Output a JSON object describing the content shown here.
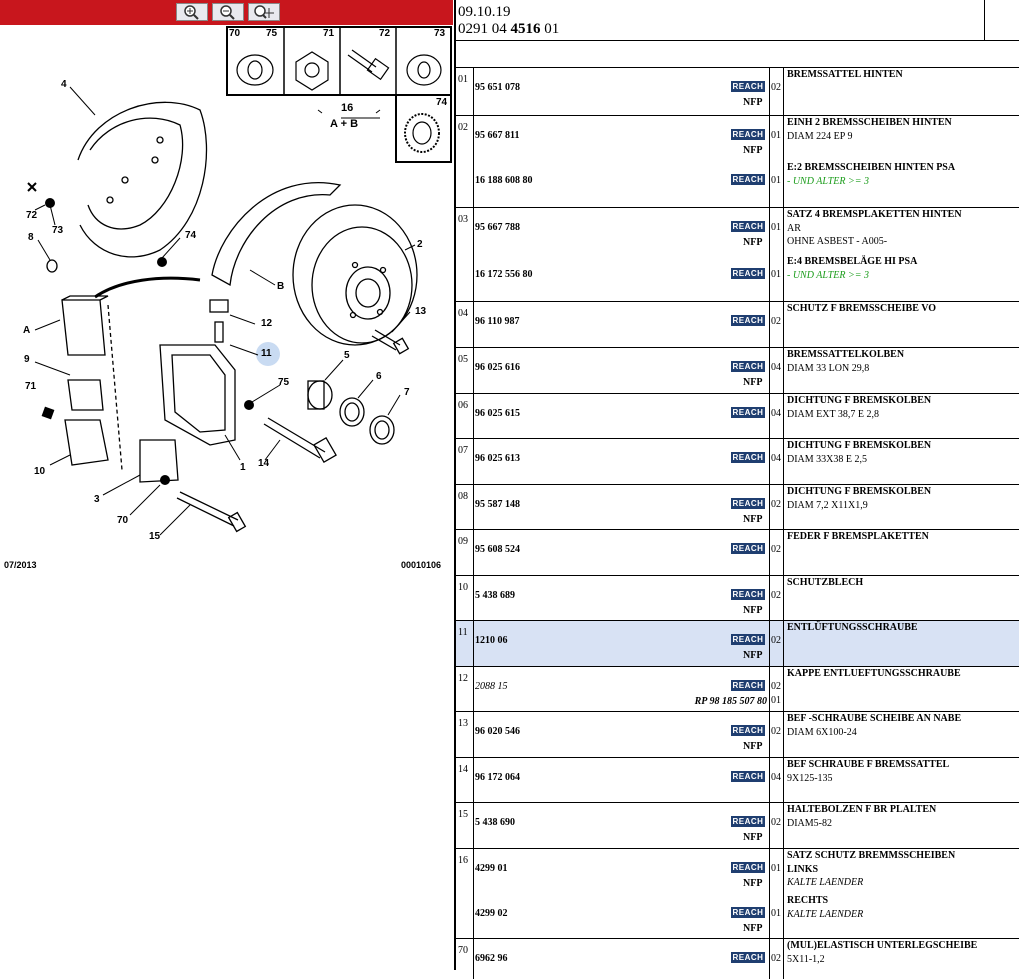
{
  "header": {
    "date": "09.10.19",
    "ref_a": "0291 04 ",
    "ref_b": "4516",
    "ref_c": " 01"
  },
  "toolbar": {
    "icons": [
      "zoom-in-icon",
      "zoom-out-icon",
      "zoom-pan-icon"
    ]
  },
  "colors": {
    "toolbar": "#c8161d",
    "reach_badge": "#1f3e70",
    "highlight": "#d8e2f4",
    "green_text": "#1a9c1a"
  },
  "diagram": {
    "inset": {
      "labels": [
        "70",
        "75",
        "71",
        "72",
        "73",
        "74"
      ],
      "group_num": "16",
      "group_sub": "A + B"
    },
    "callouts": [
      "4",
      "x",
      "72",
      "73",
      "8",
      "74",
      "B",
      "2",
      "A",
      "12",
      "13",
      "11",
      "9",
      "5",
      "71",
      "75",
      "6",
      "7",
      "1",
      "14",
      "10",
      "3",
      "70",
      "15"
    ],
    "date_code": "07/2013",
    "ref_code": "00010106"
  },
  "reach_label": "REACH",
  "rows": [
    {
      "idx": "01",
      "parts": [
        {
          "ref": "95 651 078",
          "qty": "02",
          "nfp": "NFP",
          "lines": [
            {
              "t": "BREMSSATTEL HINTEN",
              "s": "b"
            }
          ]
        }
      ]
    },
    {
      "idx": "02",
      "parts": [
        {
          "ref": "95 667 811",
          "qty": "01",
          "nfp": "NFP",
          "lines": [
            {
              "t": "EINH 2 BREMSSCHEIBEN HINTEN",
              "s": "b"
            },
            {
              "t": "DIAM 224 EP 9",
              "s": ""
            }
          ]
        },
        {
          "ref": "16 188 608 80",
          "qty": "01",
          "nfp": "",
          "lines": [
            {
              "t": "E:2 BREMSSCHEIBEN HINTEN PSA",
              "s": "b"
            },
            {
              "t": "- UND ALTER >= 3",
              "s": "g"
            }
          ]
        }
      ]
    },
    {
      "idx": "03",
      "parts": [
        {
          "ref": "95 667 788",
          "qty": "01",
          "nfp": "NFP",
          "lines": [
            {
              "t": "SATZ 4 BREMSPLAKETTEN HINTEN",
              "s": "b"
            },
            {
              "t": "AR",
              "s": ""
            },
            {
              "t": "OHNE ASBEST - A005-",
              "s": ""
            }
          ]
        },
        {
          "ref": "16 172 556 80",
          "qty": "01",
          "nfp": "",
          "lines": [
            {
              "t": "E:4 BREMSBELÄGE HI PSA",
              "s": "b"
            },
            {
              "t": "- UND ALTER >= 3",
              "s": "g"
            }
          ]
        }
      ]
    },
    {
      "idx": "04",
      "parts": [
        {
          "ref": "96 110 987",
          "qty": "02",
          "nfp": "",
          "lines": [
            {
              "t": "SCHUTZ F BREMSSCHEIBE VO",
              "s": "b"
            }
          ]
        }
      ]
    },
    {
      "idx": "05",
      "parts": [
        {
          "ref": "96 025 616",
          "qty": "04",
          "nfp": "NFP",
          "lines": [
            {
              "t": "BREMSSATTELKOLBEN",
              "s": "b"
            },
            {
              "t": "DIAM 33 LON 29,8",
              "s": ""
            }
          ]
        }
      ]
    },
    {
      "idx": "06",
      "parts": [
        {
          "ref": "96 025 615",
          "qty": "04",
          "nfp": "",
          "lines": [
            {
              "t": "DICHTUNG F BREMSKOLBEN",
              "s": "b"
            },
            {
              "t": "DIAM EXT 38,7 E 2,8",
              "s": ""
            }
          ]
        }
      ]
    },
    {
      "idx": "07",
      "parts": [
        {
          "ref": "96 025 613",
          "qty": "04",
          "nfp": "",
          "lines": [
            {
              "t": "DICHTUNG F BREMSKOLBEN",
              "s": "b"
            },
            {
              "t": "DIAM 33X38 E 2,5",
              "s": ""
            }
          ]
        }
      ]
    },
    {
      "idx": "08",
      "parts": [
        {
          "ref": "95 587 148",
          "qty": "02",
          "nfp": "NFP",
          "lines": [
            {
              "t": "DICHTUNG F BREMSKOLBEN",
              "s": "b"
            },
            {
              "t": "DIAM 7,2 X11X1,9",
              "s": ""
            }
          ]
        }
      ]
    },
    {
      "idx": "09",
      "parts": [
        {
          "ref": "95 608 524",
          "qty": "02",
          "nfp": "",
          "lines": [
            {
              "t": "FEDER F BREMSPLAKETTEN",
              "s": "b"
            }
          ]
        }
      ]
    },
    {
      "idx": "10",
      "parts": [
        {
          "ref": "5 438 689",
          "qty": "02",
          "nfp": "NFP",
          "lines": [
            {
              "t": "SCHUTZBLECH",
              "s": "b"
            }
          ]
        }
      ]
    },
    {
      "idx": "11",
      "hl": true,
      "parts": [
        {
          "ref": "1210 06",
          "qty": "02",
          "nfp": "NFP",
          "lines": [
            {
              "t": "ENTLÜFTUNGSSCHRAUBE",
              "s": "b"
            }
          ]
        }
      ]
    },
    {
      "idx": "12",
      "parts": [
        {
          "ref": "2088 15",
          "refit": true,
          "qty": "02",
          "qty2": "01",
          "nfp": "",
          "rp": "RP 98 185 507 80",
          "lines": [
            {
              "t": "KAPPE ENTLUEFTUNGSSCHRAUBE",
              "s": "b"
            }
          ]
        }
      ]
    },
    {
      "idx": "13",
      "parts": [
        {
          "ref": "96 020 546",
          "qty": "02",
          "nfp": "NFP",
          "lines": [
            {
              "t": "BEF -SCHRAUBE SCHEIBE AN NABE",
              "s": "b"
            },
            {
              "t": "DIAM 6X100-24",
              "s": ""
            }
          ]
        }
      ]
    },
    {
      "idx": "14",
      "parts": [
        {
          "ref": "96 172 064",
          "qty": "04",
          "nfp": "",
          "lines": [
            {
              "t": "BEF SCHRAUBE F BREMSSATTEL",
              "s": "b"
            },
            {
              "t": "9X125-135",
              "s": ""
            }
          ]
        }
      ]
    },
    {
      "idx": "15",
      "parts": [
        {
          "ref": "5 438 690",
          "qty": "02",
          "nfp": "NFP",
          "lines": [
            {
              "t": "HALTEBOLZEN F BR PLALTEN",
              "s": "b"
            },
            {
              "t": "DIAM5-82",
              "s": ""
            }
          ]
        }
      ]
    },
    {
      "idx": "16",
      "parts": [
        {
          "ref": "4299 01",
          "qty": "01",
          "nfp": "NFP",
          "lines": [
            {
              "t": "SATZ SCHUTZ BREMMSSCHEIBEN",
              "s": "b"
            },
            {
              "t": "LINKS",
              "s": "b"
            },
            {
              "t": "KALTE LAENDER",
              "s": "i"
            }
          ]
        },
        {
          "ref": "4299 02",
          "qty": "01",
          "nfp": "NFP",
          "lines": [
            {
              "t": "RECHTS",
              "s": "b"
            },
            {
              "t": "KALTE LAENDER",
              "s": "i"
            }
          ]
        }
      ]
    },
    {
      "idx": "70",
      "parts": [
        {
          "ref": "6962 96",
          "qty": "02",
          "nfp": "",
          "lines": [
            {
              "t": "(MUL)ELASTISCH UNTERLEGSCHEIBE",
              "s": "b"
            },
            {
              "t": "5X11-1,2",
              "s": ""
            }
          ]
        }
      ]
    }
  ]
}
